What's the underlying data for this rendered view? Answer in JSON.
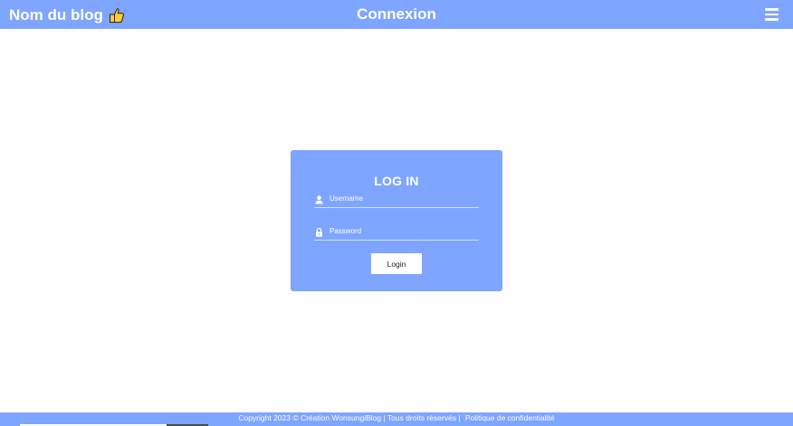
{
  "header": {
    "brand_label": "Nom du blog",
    "brand_icon": "thumbs-up-icon",
    "title": "Connexion",
    "menu_icon": "hamburger-menu-icon",
    "background_color": "#7ea5ff"
  },
  "login": {
    "title": "LOG IN",
    "username": {
      "icon": "user-icon",
      "placeholder": "Username",
      "value": ""
    },
    "password": {
      "icon": "lock-icon",
      "placeholder": "Password",
      "value": ""
    },
    "button_label": "Login",
    "card_color": "#7ea5ff"
  },
  "footer": {
    "copyright": "Copyright 2023 © Création WonsungiBlog | Tous droits réservés |",
    "privacy_link": "Politique de confidentialité",
    "background_color": "#7ea5ff"
  }
}
